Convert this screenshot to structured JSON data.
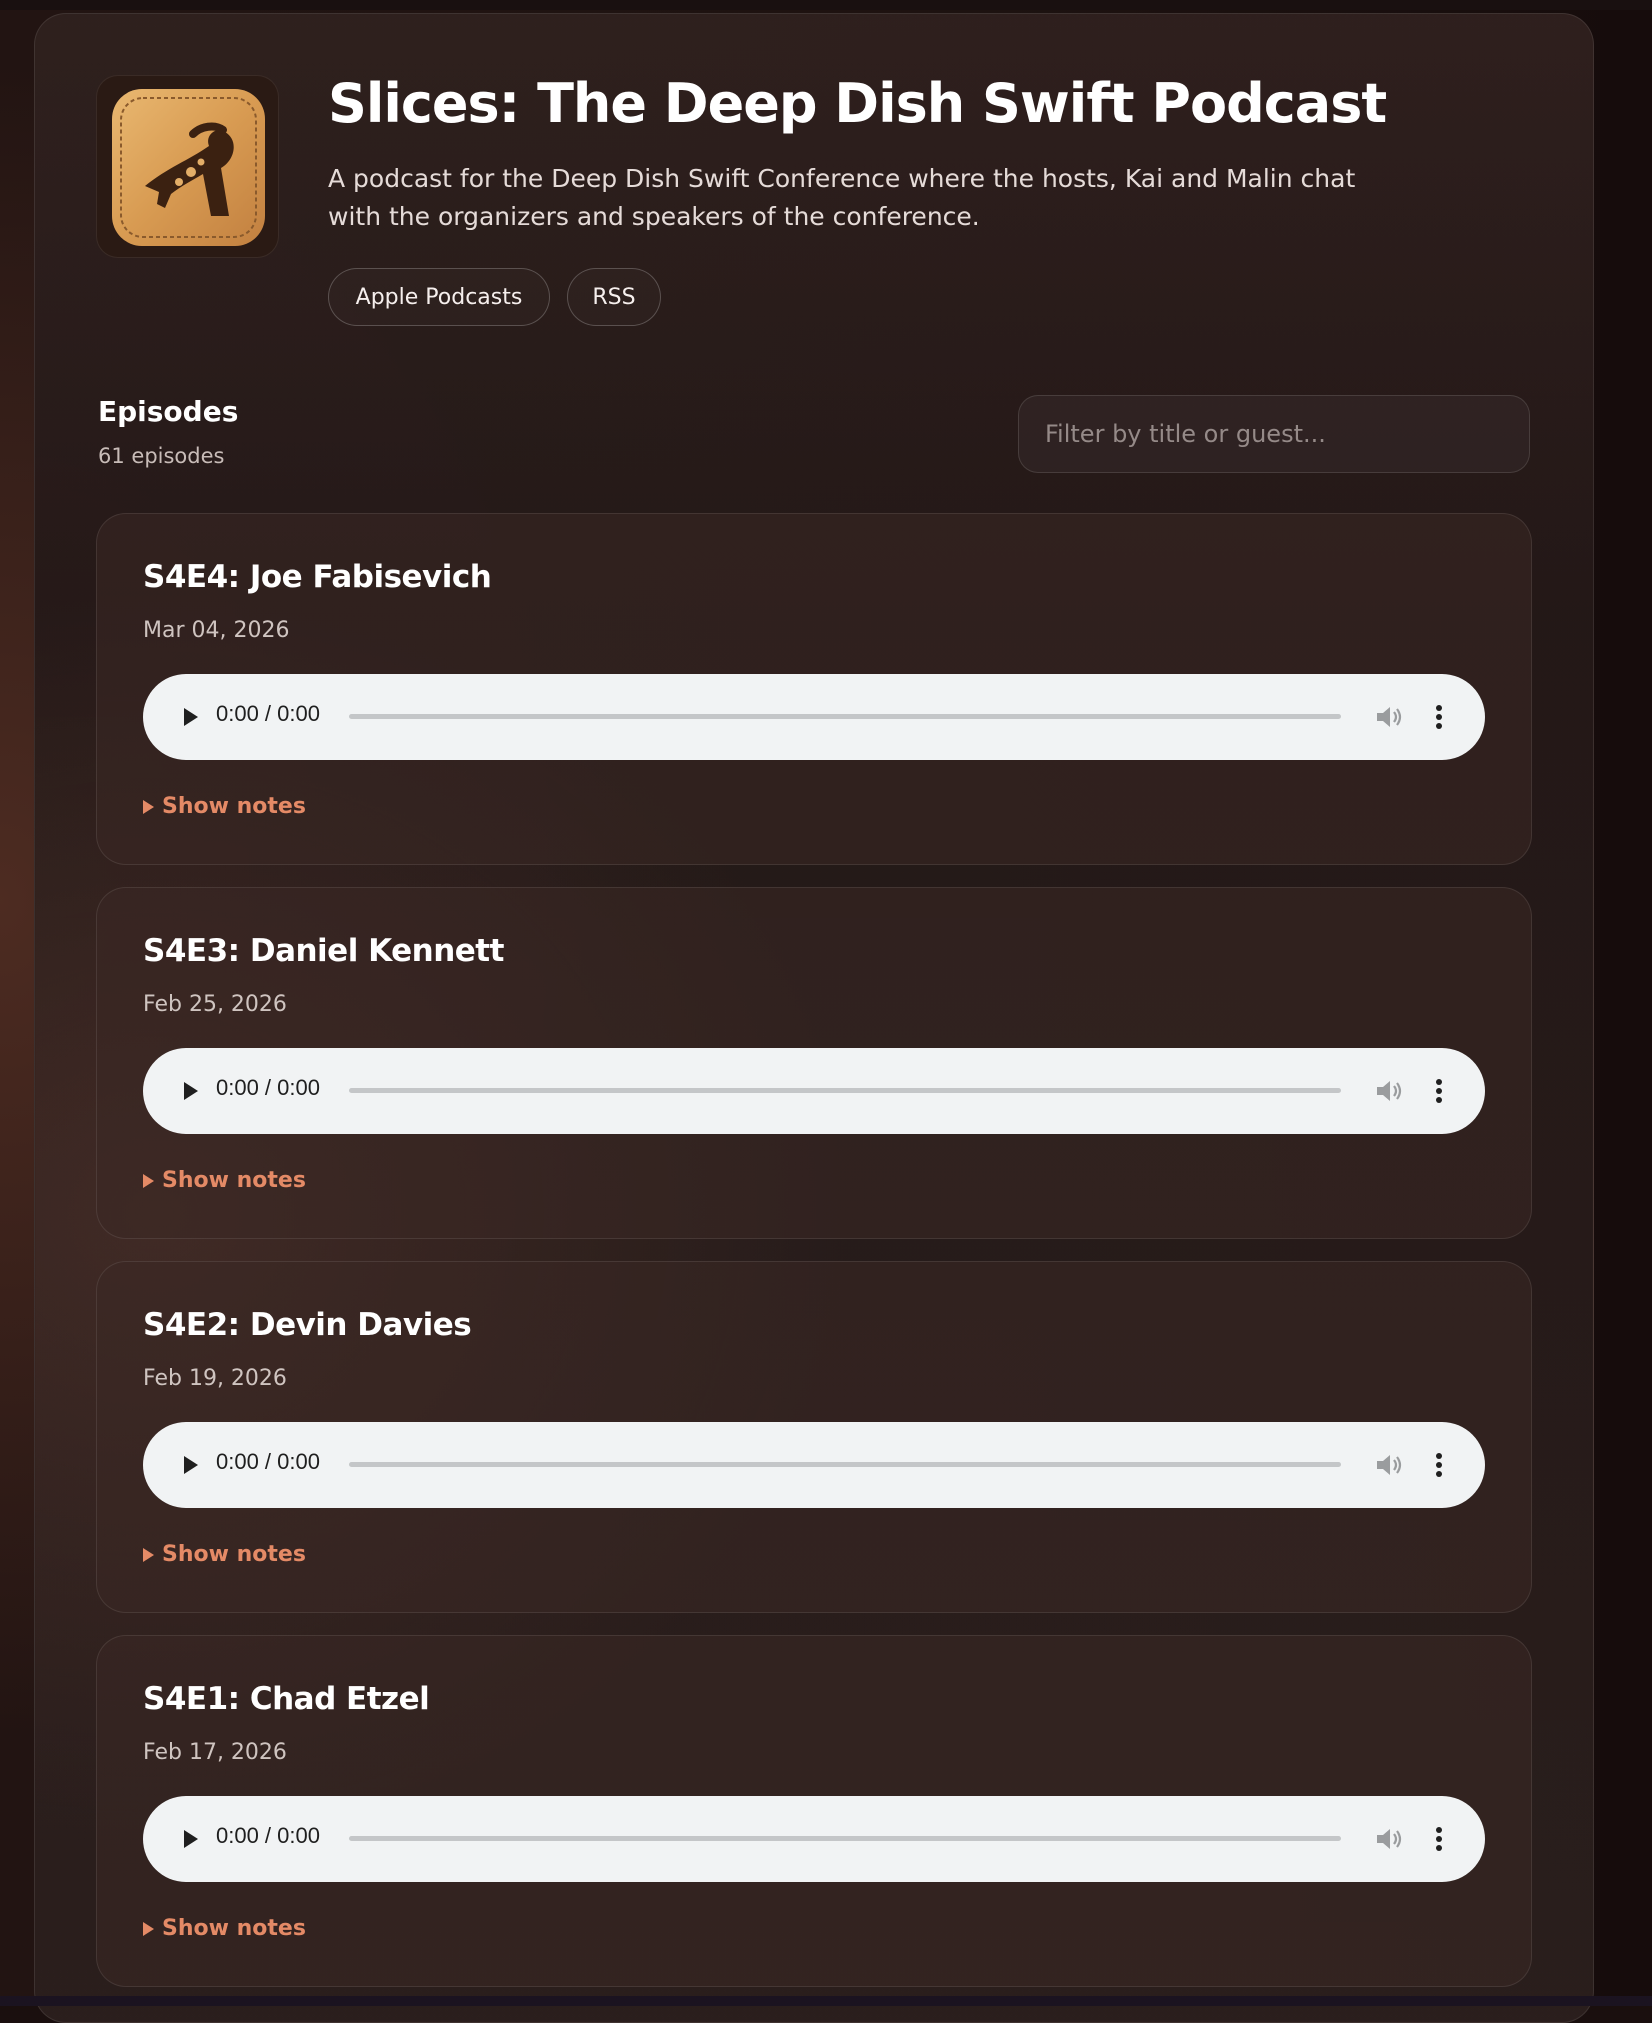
{
  "header": {
    "title": "Slices: The Deep Dish Swift Podcast",
    "description": "A podcast for the Deep Dish Swift Conference where the hosts, Kai and Malin chat with the organizers and speakers of the conference.",
    "links": {
      "apple_podcasts": "Apple Podcasts",
      "rss": "RSS"
    },
    "artwork_icon": "pizza-slice-logo-icon"
  },
  "episodes_section": {
    "heading": "Episodes",
    "count_label": "61 episodes",
    "filter_placeholder": "Filter by title or guest..."
  },
  "episodes": [
    {
      "title": "S4E4: Joe Fabisevich",
      "date": "Mar 04, 2026",
      "time": "0:00 / 0:00",
      "show_notes_label": "Show notes"
    },
    {
      "title": "S4E3: Daniel Kennett",
      "date": "Feb 25, 2026",
      "time": "0:00 / 0:00",
      "show_notes_label": "Show notes"
    },
    {
      "title": "S4E2: Devin Davies",
      "date": "Feb 19, 2026",
      "time": "0:00 / 0:00",
      "show_notes_label": "Show notes"
    },
    {
      "title": "S4E1: Chad Etzel",
      "date": "Feb 17, 2026",
      "time": "0:00 / 0:00",
      "show_notes_label": "Show notes"
    }
  ],
  "colors": {
    "accent": "#e48a66",
    "player_bg": "#f1f3f4",
    "page_bg": "#1a0f0e"
  }
}
